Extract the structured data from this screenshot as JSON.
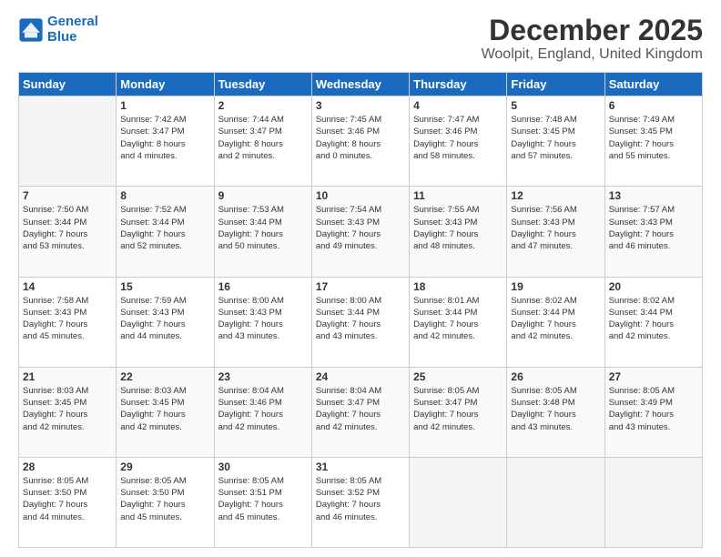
{
  "header": {
    "logo_general": "General",
    "logo_blue": "Blue",
    "title": "December 2025",
    "subtitle": "Woolpit, England, United Kingdom"
  },
  "calendar": {
    "days_of_week": [
      "Sunday",
      "Monday",
      "Tuesday",
      "Wednesday",
      "Thursday",
      "Friday",
      "Saturday"
    ],
    "weeks": [
      [
        {
          "day": "",
          "info": ""
        },
        {
          "day": "1",
          "info": "Sunrise: 7:42 AM\nSunset: 3:47 PM\nDaylight: 8 hours\nand 4 minutes."
        },
        {
          "day": "2",
          "info": "Sunrise: 7:44 AM\nSunset: 3:47 PM\nDaylight: 8 hours\nand 2 minutes."
        },
        {
          "day": "3",
          "info": "Sunrise: 7:45 AM\nSunset: 3:46 PM\nDaylight: 8 hours\nand 0 minutes."
        },
        {
          "day": "4",
          "info": "Sunrise: 7:47 AM\nSunset: 3:46 PM\nDaylight: 7 hours\nand 58 minutes."
        },
        {
          "day": "5",
          "info": "Sunrise: 7:48 AM\nSunset: 3:45 PM\nDaylight: 7 hours\nand 57 minutes."
        },
        {
          "day": "6",
          "info": "Sunrise: 7:49 AM\nSunset: 3:45 PM\nDaylight: 7 hours\nand 55 minutes."
        }
      ],
      [
        {
          "day": "7",
          "info": "Sunrise: 7:50 AM\nSunset: 3:44 PM\nDaylight: 7 hours\nand 53 minutes."
        },
        {
          "day": "8",
          "info": "Sunrise: 7:52 AM\nSunset: 3:44 PM\nDaylight: 7 hours\nand 52 minutes."
        },
        {
          "day": "9",
          "info": "Sunrise: 7:53 AM\nSunset: 3:44 PM\nDaylight: 7 hours\nand 50 minutes."
        },
        {
          "day": "10",
          "info": "Sunrise: 7:54 AM\nSunset: 3:43 PM\nDaylight: 7 hours\nand 49 minutes."
        },
        {
          "day": "11",
          "info": "Sunrise: 7:55 AM\nSunset: 3:43 PM\nDaylight: 7 hours\nand 48 minutes."
        },
        {
          "day": "12",
          "info": "Sunrise: 7:56 AM\nSunset: 3:43 PM\nDaylight: 7 hours\nand 47 minutes."
        },
        {
          "day": "13",
          "info": "Sunrise: 7:57 AM\nSunset: 3:43 PM\nDaylight: 7 hours\nand 46 minutes."
        }
      ],
      [
        {
          "day": "14",
          "info": "Sunrise: 7:58 AM\nSunset: 3:43 PM\nDaylight: 7 hours\nand 45 minutes."
        },
        {
          "day": "15",
          "info": "Sunrise: 7:59 AM\nSunset: 3:43 PM\nDaylight: 7 hours\nand 44 minutes."
        },
        {
          "day": "16",
          "info": "Sunrise: 8:00 AM\nSunset: 3:43 PM\nDaylight: 7 hours\nand 43 minutes."
        },
        {
          "day": "17",
          "info": "Sunrise: 8:00 AM\nSunset: 3:44 PM\nDaylight: 7 hours\nand 43 minutes."
        },
        {
          "day": "18",
          "info": "Sunrise: 8:01 AM\nSunset: 3:44 PM\nDaylight: 7 hours\nand 42 minutes."
        },
        {
          "day": "19",
          "info": "Sunrise: 8:02 AM\nSunset: 3:44 PM\nDaylight: 7 hours\nand 42 minutes."
        },
        {
          "day": "20",
          "info": "Sunrise: 8:02 AM\nSunset: 3:44 PM\nDaylight: 7 hours\nand 42 minutes."
        }
      ],
      [
        {
          "day": "21",
          "info": "Sunrise: 8:03 AM\nSunset: 3:45 PM\nDaylight: 7 hours\nand 42 minutes."
        },
        {
          "day": "22",
          "info": "Sunrise: 8:03 AM\nSunset: 3:45 PM\nDaylight: 7 hours\nand 42 minutes."
        },
        {
          "day": "23",
          "info": "Sunrise: 8:04 AM\nSunset: 3:46 PM\nDaylight: 7 hours\nand 42 minutes."
        },
        {
          "day": "24",
          "info": "Sunrise: 8:04 AM\nSunset: 3:47 PM\nDaylight: 7 hours\nand 42 minutes."
        },
        {
          "day": "25",
          "info": "Sunrise: 8:05 AM\nSunset: 3:47 PM\nDaylight: 7 hours\nand 42 minutes."
        },
        {
          "day": "26",
          "info": "Sunrise: 8:05 AM\nSunset: 3:48 PM\nDaylight: 7 hours\nand 43 minutes."
        },
        {
          "day": "27",
          "info": "Sunrise: 8:05 AM\nSunset: 3:49 PM\nDaylight: 7 hours\nand 43 minutes."
        }
      ],
      [
        {
          "day": "28",
          "info": "Sunrise: 8:05 AM\nSunset: 3:50 PM\nDaylight: 7 hours\nand 44 minutes."
        },
        {
          "day": "29",
          "info": "Sunrise: 8:05 AM\nSunset: 3:50 PM\nDaylight: 7 hours\nand 45 minutes."
        },
        {
          "day": "30",
          "info": "Sunrise: 8:05 AM\nSunset: 3:51 PM\nDaylight: 7 hours\nand 45 minutes."
        },
        {
          "day": "31",
          "info": "Sunrise: 8:05 AM\nSunset: 3:52 PM\nDaylight: 7 hours\nand 46 minutes."
        },
        {
          "day": "",
          "info": ""
        },
        {
          "day": "",
          "info": ""
        },
        {
          "day": "",
          "info": ""
        }
      ]
    ]
  }
}
